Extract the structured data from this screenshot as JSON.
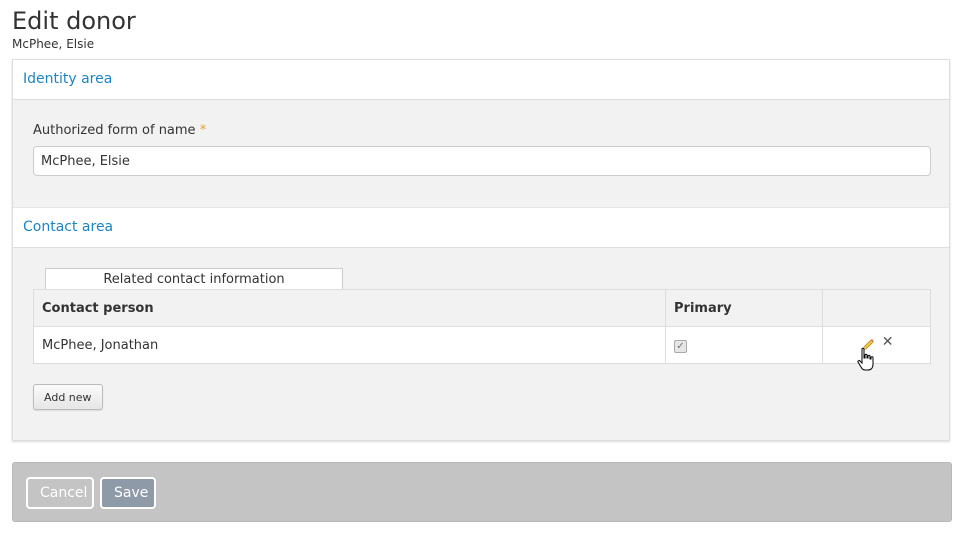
{
  "page": {
    "title": "Edit donor",
    "subtitle": "McPhee, Elsie"
  },
  "identity_area": {
    "header": "Identity area",
    "authorized_name_label": "Authorized form of name",
    "required_marker": "*",
    "authorized_name_value": "McPhee, Elsie"
  },
  "contact_area": {
    "header": "Contact area",
    "tab_label": "Related contact information",
    "table": {
      "columns": [
        "Contact person",
        "Primary",
        ""
      ],
      "rows": [
        {
          "contact_person": "McPhee, Jonathan",
          "primary": true,
          "primary_glyph": "✓"
        }
      ]
    },
    "add_new_label": "Add new"
  },
  "actions": {
    "cancel_label": "Cancel",
    "save_label": "Save"
  },
  "icons": {
    "edit": "pencil-icon",
    "delete": "close-icon",
    "cursor": "hand-pointer-cursor-icon"
  },
  "colors": {
    "link_blue": "#1c84c6",
    "required_orange": "#f0a030",
    "actions_bar_bg": "#c4c4c4",
    "save_button_bg": "#8e9aa8"
  }
}
